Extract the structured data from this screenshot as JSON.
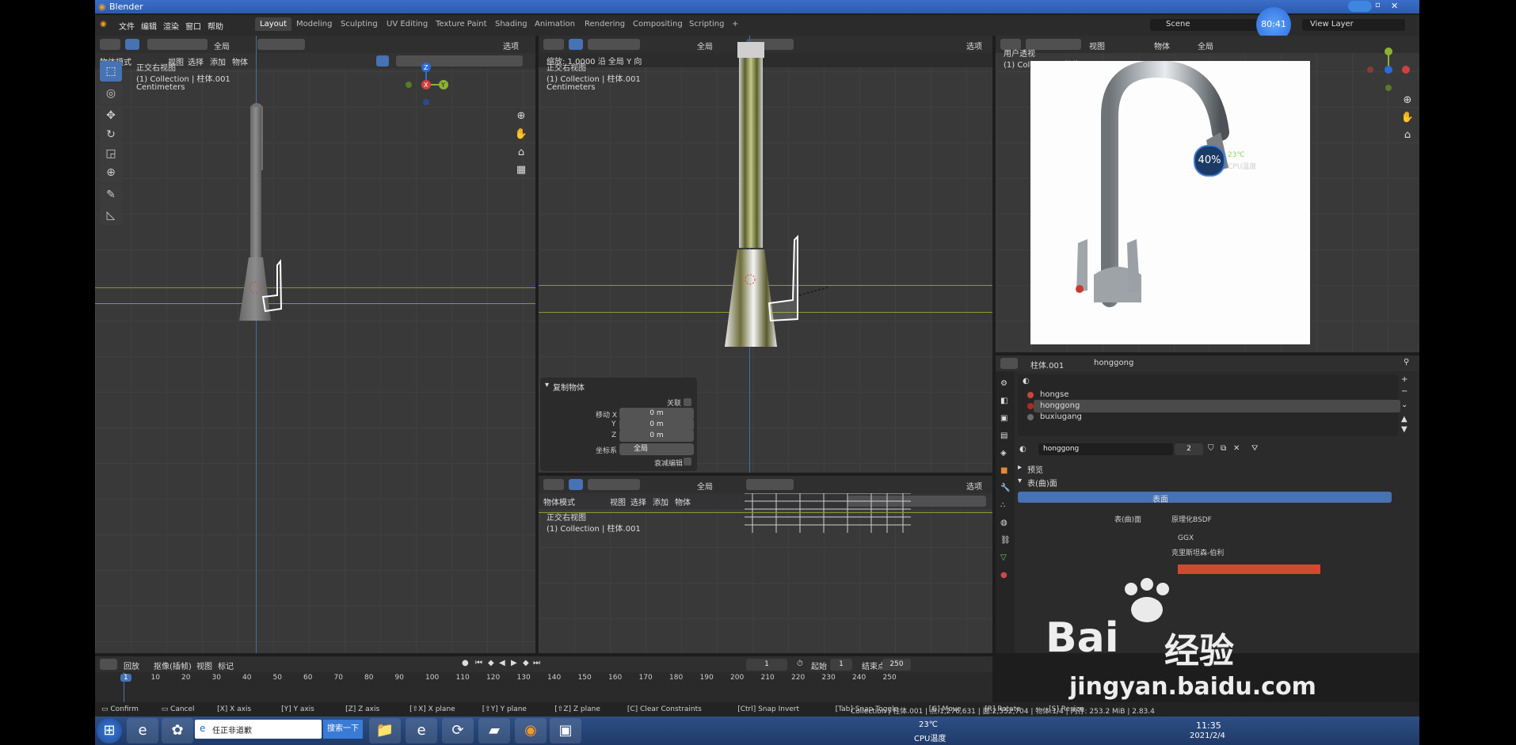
{
  "window": {
    "title": "Blender"
  },
  "menu": [
    "文件",
    "编辑",
    "渲染",
    "窗口",
    "帮助"
  ],
  "workspaces": [
    "Layout",
    "Modeling",
    "Sculpting",
    "UV Editing",
    "Texture Paint",
    "Shading",
    "Animation",
    "Rendering",
    "Compositing",
    "Scripting",
    "+"
  ],
  "active_workspace": "Layout",
  "scene": {
    "name": "Scene",
    "view_layer": "View Layer",
    "clock": "80:41"
  },
  "left_view": {
    "transform_orientation": "全局",
    "options": "选项",
    "mode": "物体模式",
    "menus": [
      "视图",
      "选择",
      "添加",
      "物体"
    ],
    "overlay_title": "正交右视图",
    "collection": "(1) Collection | 柱体.001",
    "units": "Centimeters",
    "axes": {
      "x": "X",
      "y": "Y",
      "z": "Z"
    }
  },
  "mid_view": {
    "transform_orientation": "全局",
    "options": "选项",
    "scale_info": "缩放: 1.0000 沿 全局 Y 向",
    "overlay_title": "正交右视图",
    "collection": "(1) Collection | 柱体.001",
    "units": "Centimeters"
  },
  "duplicate_panel": {
    "title": "复制物体",
    "linked_label": "关联",
    "move_x_label": "移动 X",
    "move_x": "0 m",
    "y_label": "Y",
    "move_y": "0 m",
    "z_label": "Z",
    "move_z": "0 m",
    "orient_label": "坐标系",
    "orient_value": "全局",
    "prop_edit_label": "衰减编辑"
  },
  "bottom_view": {
    "transform_orientation": "全局",
    "options": "选项",
    "mode": "物体模式",
    "menus": [
      "视图",
      "选择",
      "添加",
      "物体"
    ],
    "overlay_title": "正交右视图",
    "collection": "(1) Collection | 柱体.001"
  },
  "right_view": {
    "menus": [
      "视图",
      "物体"
    ],
    "transform_orientation": "全局",
    "overlay_title": "用户透视",
    "collection": "(1) Collection | 柱体.001"
  },
  "cpu_widget": {
    "percent": "40%",
    "temp": "23℃",
    "label": "CPU温度"
  },
  "properties": {
    "object_name": "柱体.001",
    "material_name": "honggong",
    "slots": [
      "hongse",
      "honggong",
      "buxiugang"
    ],
    "active_slot": "honggong",
    "slot_colors": [
      "#c8463c",
      "#b02a20",
      "#6a6a6a"
    ],
    "material_field": "honggong",
    "users": "2",
    "preview_label": "预览",
    "surface_label": "表(曲)面",
    "surface_shader": "表面",
    "sub_labels": [
      "表(曲)面",
      "原理化BSDF",
      "GGX",
      "克里斯坦森-伯利"
    ]
  },
  "timeline": {
    "menus": [
      "回放",
      "抠像(插帧)",
      "视图",
      "标记"
    ],
    "current_frame": "1",
    "start_label": "起始",
    "start": "1",
    "end_label": "结束点",
    "end": "250",
    "ticks": [
      "1",
      "10",
      "20",
      "30",
      "40",
      "50",
      "60",
      "70",
      "80",
      "90",
      "100",
      "110",
      "120",
      "130",
      "140",
      "150",
      "160",
      "170",
      "180",
      "190",
      "200",
      "210",
      "220",
      "230",
      "240",
      "250"
    ]
  },
  "status": {
    "hints": [
      {
        "key": "",
        "label": "Confirm"
      },
      {
        "key": "",
        "label": "Cancel"
      },
      {
        "key": "X",
        "label": "X axis"
      },
      {
        "key": "Y",
        "label": "Y axis"
      },
      {
        "key": "Z",
        "label": "Z axis"
      },
      {
        "key": "⇧X",
        "label": "X plane"
      },
      {
        "key": "⇧Y",
        "label": "Y plane"
      },
      {
        "key": "⇧Z",
        "label": "Z plane"
      },
      {
        "key": "C",
        "label": "Clear Constraints"
      },
      {
        "key": "Ctrl",
        "label": "Snap Invert"
      },
      {
        "key": "Tab",
        "label": "Snap Toggle"
      },
      {
        "key": "G",
        "label": "Move"
      },
      {
        "key": "R",
        "label": "Rotate"
      },
      {
        "key": "S",
        "label": "Resize"
      }
    ],
    "scene_stats": "Collection | 柱体.001 | 点:1,276,631 | 面:2,552,704 | 物体:1/4 | 内存: 253.2 MiB | 2.83.4",
    "scene_stats_prefix": "8,352"
  },
  "taskbar": {
    "search_text": "任正非道歉",
    "search_button": "搜索一下",
    "temp": "23℃",
    "temp_label": "CPU温度",
    "time": "11:35",
    "date": "2021/2/4"
  },
  "watermark": {
    "brand": "Bai",
    "brand_cn": "经验",
    "url": "jingyan.baidu.com"
  }
}
